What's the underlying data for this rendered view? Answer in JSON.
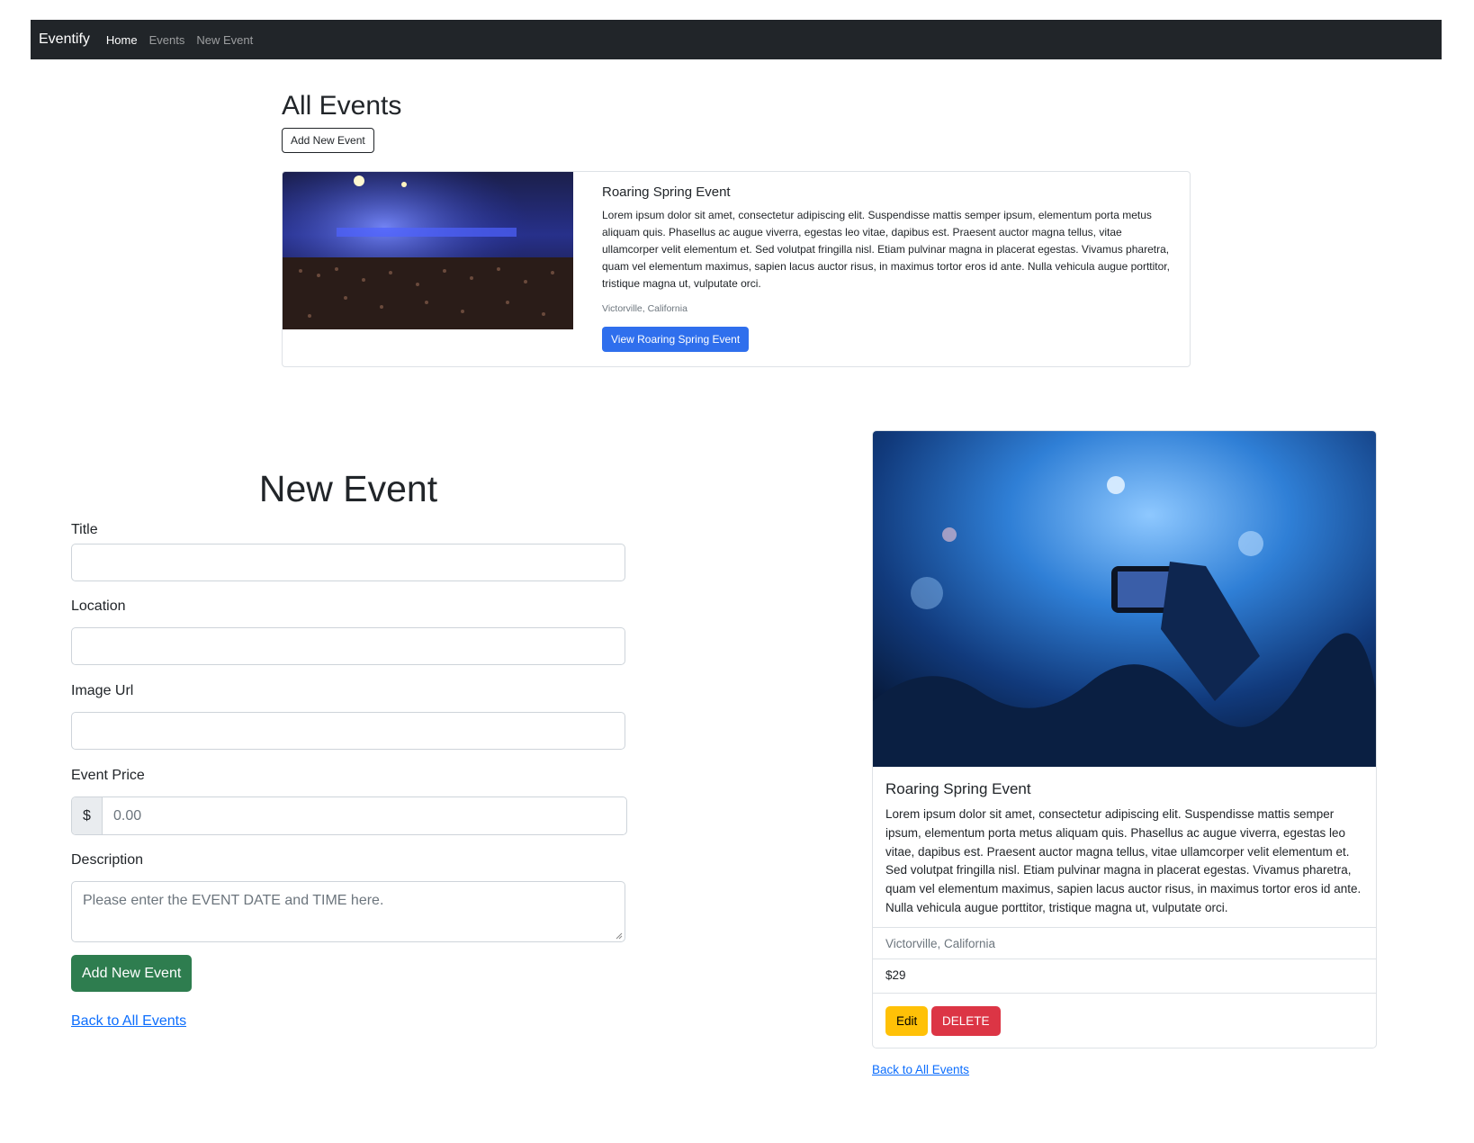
{
  "navbar": {
    "brand": "Eventify",
    "links": [
      {
        "label": "Home",
        "active": true
      },
      {
        "label": "Events",
        "active": false
      },
      {
        "label": "New Event",
        "active": false
      }
    ]
  },
  "all_events": {
    "heading": "All Events",
    "add_button": "Add New Event",
    "event": {
      "title": "Roaring Spring Event",
      "description": "Lorem ipsum dolor sit amet, consectetur adipiscing elit. Suspendisse mattis semper ipsum, elementum porta metus aliquam quis. Phasellus ac augue viverra, egestas leo vitae, dapibus est. Praesent auctor magna tellus, vitae ullamcorper velit elementum et. Sed volutpat fringilla nisl. Etiam pulvinar magna in placerat egestas. Vivamus pharetra, quam vel elementum maximus, sapien lacus auctor risus, in maximus tortor eros id ante. Nulla vehicula augue porttitor, tristique magna ut, vulputate orci.",
      "location": "Victorville, California",
      "view_button": "View Roaring Spring Event"
    }
  },
  "new_event_form": {
    "heading": "New Event",
    "fields": {
      "title_label": "Title",
      "location_label": "Location",
      "image_url_label": "Image Url",
      "price_label": "Event Price",
      "price_prefix": "$",
      "price_placeholder": "0.00",
      "description_label": "Description",
      "description_placeholder": "Please enter the EVENT DATE and TIME here."
    },
    "submit_button": "Add New Event",
    "back_link": "Back to All Events"
  },
  "event_detail": {
    "title": "Roaring Spring Event",
    "description": "Lorem ipsum dolor sit amet, consectetur adipiscing elit. Suspendisse mattis semper ipsum, elementum porta metus aliquam quis. Phasellus ac augue viverra, egestas leo vitae, dapibus est. Praesent auctor magna tellus, vitae ullamcorper velit elementum et. Sed volutpat fringilla nisl. Etiam pulvinar magna in placerat egestas. Vivamus pharetra, quam vel elementum maximus, sapien lacus auctor risus, in maximus tortor eros id ante. Nulla vehicula augue porttitor, tristique magna ut, vulputate orci.",
    "location": "Victorville, California",
    "price": "$29",
    "edit_button": "Edit",
    "delete_button": "DELETE",
    "back_link": "Back to All Events"
  },
  "colors": {
    "navbar": "#212529",
    "primary": "#2f6fed",
    "success": "#2e7d4f",
    "warning": "#ffc107",
    "danger": "#dc3545",
    "link": "#0d6efd"
  }
}
